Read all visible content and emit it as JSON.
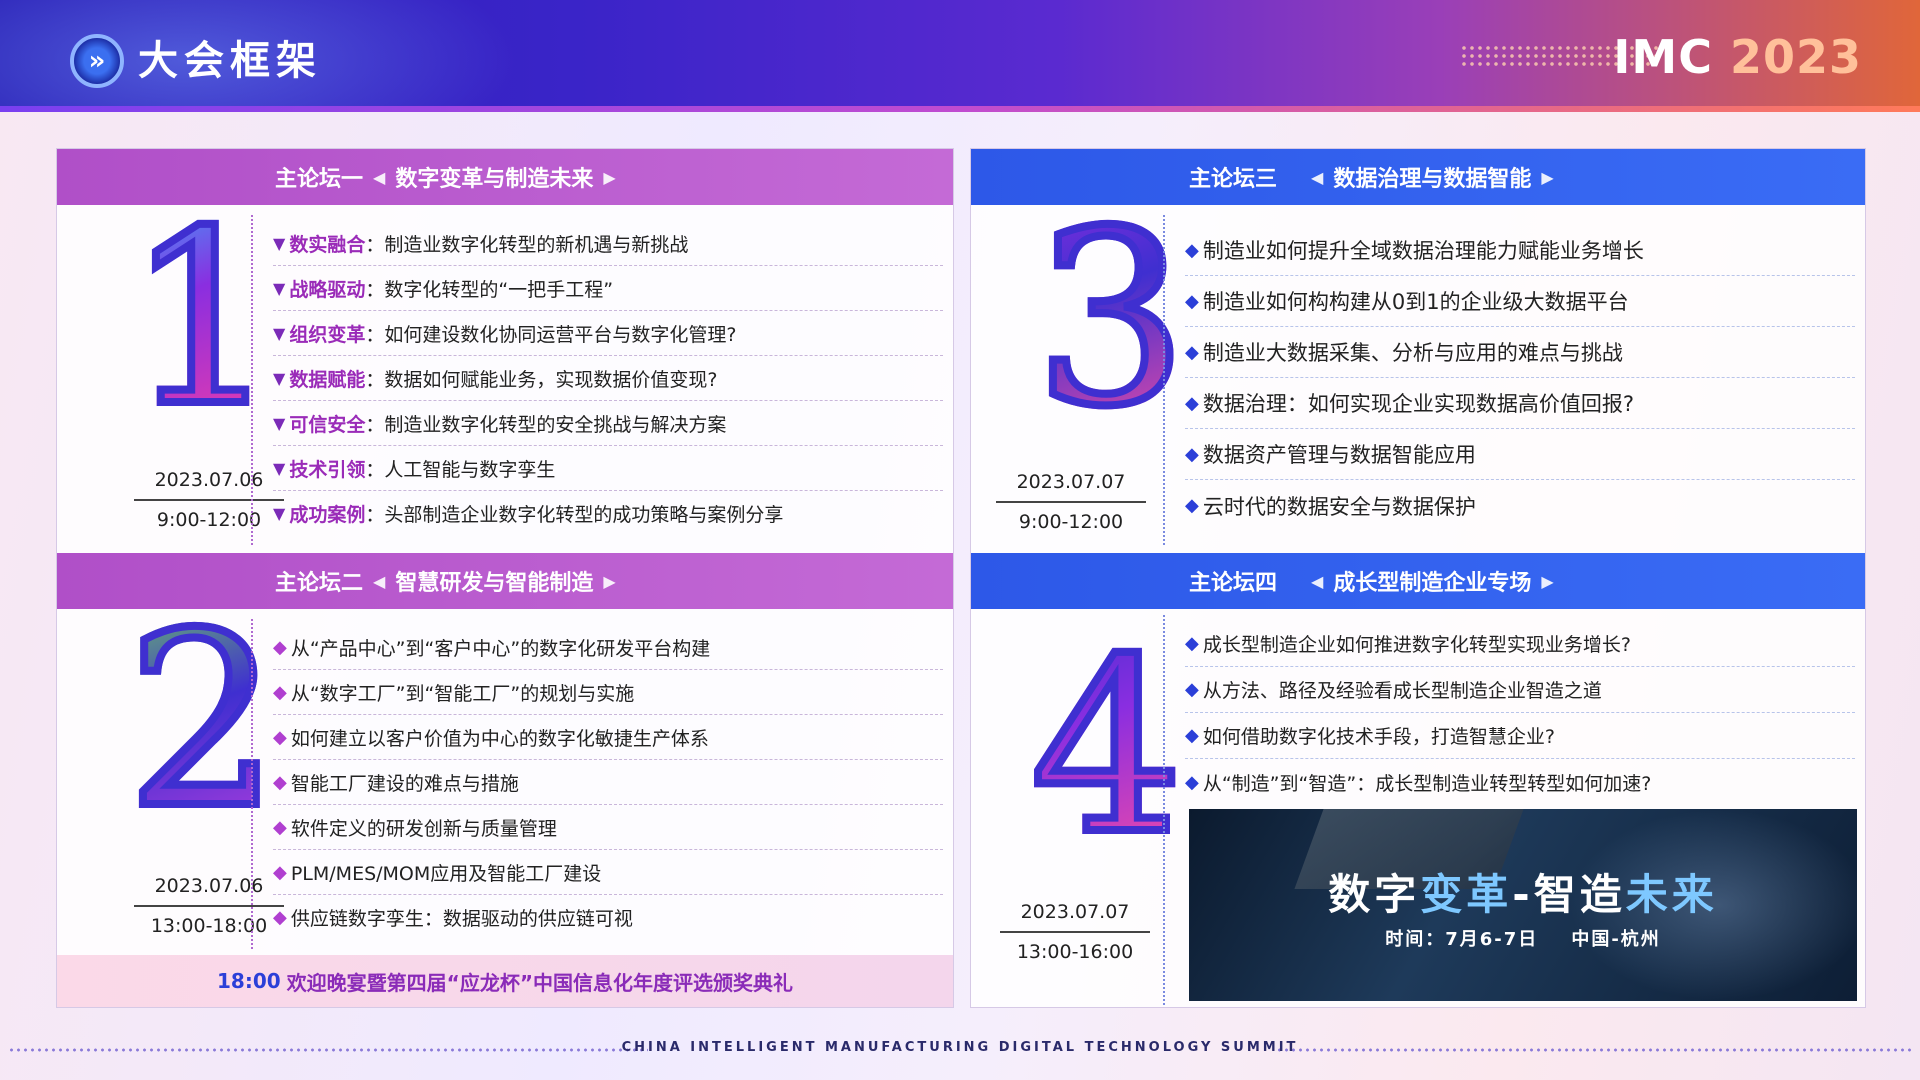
{
  "header": {
    "title": "大会框架",
    "brand": "IMC",
    "year": "2023"
  },
  "forums": [
    {
      "label": "主论坛一",
      "theme": "数字变革与制造未来",
      "number": "1",
      "date": "2023.07.06",
      "time": "9:00-12:00",
      "items": [
        {
          "kw": "数实融合",
          "text": "制造业数字化转型的新机遇与新挑战"
        },
        {
          "kw": "战略驱动",
          "text": "数字化转型的“一把手工程”"
        },
        {
          "kw": "组织变革",
          "text": "如何建设数化协同运营平台与数字化管理?"
        },
        {
          "kw": "数据赋能",
          "text": "数据如何赋能业务，实现数据价值变现?"
        },
        {
          "kw": "可信安全",
          "text": "制造业数字化转型的安全挑战与解决方案"
        },
        {
          "kw": "技术引领",
          "text": "人工智能与数字孪生"
        },
        {
          "kw": "成功案例",
          "text": "头部制造企业数字化转型的成功策略与案例分享"
        }
      ]
    },
    {
      "label": "主论坛二",
      "theme": "智慧研发与智能制造",
      "number": "2",
      "date": "2023.07.06",
      "time": "13:00-18:00",
      "items": [
        "从“产品中心”到“客户中心”的数字化研发平台构建",
        "从“数字工厂”到“智能工厂”的规划与实施",
        "如何建立以客户价值为中心的数字化敏捷生产体系",
        "智能工厂建设的难点与措施",
        "软件定义的研发创新与质量管理",
        "PLM/MES/MOM应用及智能工厂建设",
        "供应链数字孪生：数据驱动的供应链可视"
      ],
      "evening_time": "18:00",
      "evening_text": "欢迎晚宴暨第四届“应龙杯”中国信息化年度评选颁奖典礼"
    },
    {
      "label": "主论坛三",
      "theme": "数据治理与数据智能",
      "number": "3",
      "date": "2023.07.07",
      "time": "9:00-12:00",
      "items": [
        "制造业如何提升全域数据治理能力赋能业务增长",
        "制造业如何构构建从0到1的企业级大数据平台",
        "制造业大数据采集、分析与应用的难点与挑战",
        "数据治理：如何实现企业实现数据高价值回报?",
        "数据资产管理与数据智能应用",
        "云时代的数据安全与数据保护"
      ]
    },
    {
      "label": "主论坛四",
      "theme": "成长型制造企业专场",
      "number": "4",
      "date": "2023.07.07",
      "time": "13:00-16:00",
      "items": [
        "成长型制造企业如何推进数字化转型实现业务增长?",
        "从方法、路径及经验看成长型制造企业智造之道",
        "如何借助数字化技术手段，打造智慧企业?",
        "从“制造”到“智造”：成长型制造业转型转型如何加速?"
      ]
    }
  ],
  "banner": {
    "title_a": "数字",
    "title_b": "变革",
    "title_c": "-智造",
    "title_d": "未来",
    "sub": "时间：7月6-7日    中国-杭州"
  },
  "footer": "CHINA INTELLIGENT MANUFACTURING DIGITAL TECHNOLOGY SUMMIT"
}
